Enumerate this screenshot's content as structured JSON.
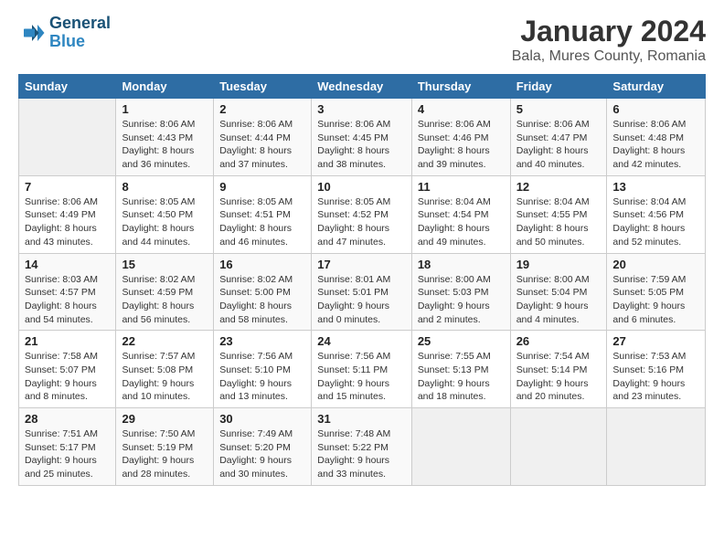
{
  "header": {
    "logo_line1": "General",
    "logo_line2": "Blue",
    "month": "January 2024",
    "location": "Bala, Mures County, Romania"
  },
  "weekdays": [
    "Sunday",
    "Monday",
    "Tuesday",
    "Wednesday",
    "Thursday",
    "Friday",
    "Saturday"
  ],
  "weeks": [
    [
      {
        "day": "",
        "info": ""
      },
      {
        "day": "1",
        "info": "Sunrise: 8:06 AM\nSunset: 4:43 PM\nDaylight: 8 hours\nand 36 minutes."
      },
      {
        "day": "2",
        "info": "Sunrise: 8:06 AM\nSunset: 4:44 PM\nDaylight: 8 hours\nand 37 minutes."
      },
      {
        "day": "3",
        "info": "Sunrise: 8:06 AM\nSunset: 4:45 PM\nDaylight: 8 hours\nand 38 minutes."
      },
      {
        "day": "4",
        "info": "Sunrise: 8:06 AM\nSunset: 4:46 PM\nDaylight: 8 hours\nand 39 minutes."
      },
      {
        "day": "5",
        "info": "Sunrise: 8:06 AM\nSunset: 4:47 PM\nDaylight: 8 hours\nand 40 minutes."
      },
      {
        "day": "6",
        "info": "Sunrise: 8:06 AM\nSunset: 4:48 PM\nDaylight: 8 hours\nand 42 minutes."
      }
    ],
    [
      {
        "day": "7",
        "info": "Sunrise: 8:06 AM\nSunset: 4:49 PM\nDaylight: 8 hours\nand 43 minutes."
      },
      {
        "day": "8",
        "info": "Sunrise: 8:05 AM\nSunset: 4:50 PM\nDaylight: 8 hours\nand 44 minutes."
      },
      {
        "day": "9",
        "info": "Sunrise: 8:05 AM\nSunset: 4:51 PM\nDaylight: 8 hours\nand 46 minutes."
      },
      {
        "day": "10",
        "info": "Sunrise: 8:05 AM\nSunset: 4:52 PM\nDaylight: 8 hours\nand 47 minutes."
      },
      {
        "day": "11",
        "info": "Sunrise: 8:04 AM\nSunset: 4:54 PM\nDaylight: 8 hours\nand 49 minutes."
      },
      {
        "day": "12",
        "info": "Sunrise: 8:04 AM\nSunset: 4:55 PM\nDaylight: 8 hours\nand 50 minutes."
      },
      {
        "day": "13",
        "info": "Sunrise: 8:04 AM\nSunset: 4:56 PM\nDaylight: 8 hours\nand 52 minutes."
      }
    ],
    [
      {
        "day": "14",
        "info": "Sunrise: 8:03 AM\nSunset: 4:57 PM\nDaylight: 8 hours\nand 54 minutes."
      },
      {
        "day": "15",
        "info": "Sunrise: 8:02 AM\nSunset: 4:59 PM\nDaylight: 8 hours\nand 56 minutes."
      },
      {
        "day": "16",
        "info": "Sunrise: 8:02 AM\nSunset: 5:00 PM\nDaylight: 8 hours\nand 58 minutes."
      },
      {
        "day": "17",
        "info": "Sunrise: 8:01 AM\nSunset: 5:01 PM\nDaylight: 9 hours\nand 0 minutes."
      },
      {
        "day": "18",
        "info": "Sunrise: 8:00 AM\nSunset: 5:03 PM\nDaylight: 9 hours\nand 2 minutes."
      },
      {
        "day": "19",
        "info": "Sunrise: 8:00 AM\nSunset: 5:04 PM\nDaylight: 9 hours\nand 4 minutes."
      },
      {
        "day": "20",
        "info": "Sunrise: 7:59 AM\nSunset: 5:05 PM\nDaylight: 9 hours\nand 6 minutes."
      }
    ],
    [
      {
        "day": "21",
        "info": "Sunrise: 7:58 AM\nSunset: 5:07 PM\nDaylight: 9 hours\nand 8 minutes."
      },
      {
        "day": "22",
        "info": "Sunrise: 7:57 AM\nSunset: 5:08 PM\nDaylight: 9 hours\nand 10 minutes."
      },
      {
        "day": "23",
        "info": "Sunrise: 7:56 AM\nSunset: 5:10 PM\nDaylight: 9 hours\nand 13 minutes."
      },
      {
        "day": "24",
        "info": "Sunrise: 7:56 AM\nSunset: 5:11 PM\nDaylight: 9 hours\nand 15 minutes."
      },
      {
        "day": "25",
        "info": "Sunrise: 7:55 AM\nSunset: 5:13 PM\nDaylight: 9 hours\nand 18 minutes."
      },
      {
        "day": "26",
        "info": "Sunrise: 7:54 AM\nSunset: 5:14 PM\nDaylight: 9 hours\nand 20 minutes."
      },
      {
        "day": "27",
        "info": "Sunrise: 7:53 AM\nSunset: 5:16 PM\nDaylight: 9 hours\nand 23 minutes."
      }
    ],
    [
      {
        "day": "28",
        "info": "Sunrise: 7:51 AM\nSunset: 5:17 PM\nDaylight: 9 hours\nand 25 minutes."
      },
      {
        "day": "29",
        "info": "Sunrise: 7:50 AM\nSunset: 5:19 PM\nDaylight: 9 hours\nand 28 minutes."
      },
      {
        "day": "30",
        "info": "Sunrise: 7:49 AM\nSunset: 5:20 PM\nDaylight: 9 hours\nand 30 minutes."
      },
      {
        "day": "31",
        "info": "Sunrise: 7:48 AM\nSunset: 5:22 PM\nDaylight: 9 hours\nand 33 minutes."
      },
      {
        "day": "",
        "info": ""
      },
      {
        "day": "",
        "info": ""
      },
      {
        "day": "",
        "info": ""
      }
    ]
  ]
}
